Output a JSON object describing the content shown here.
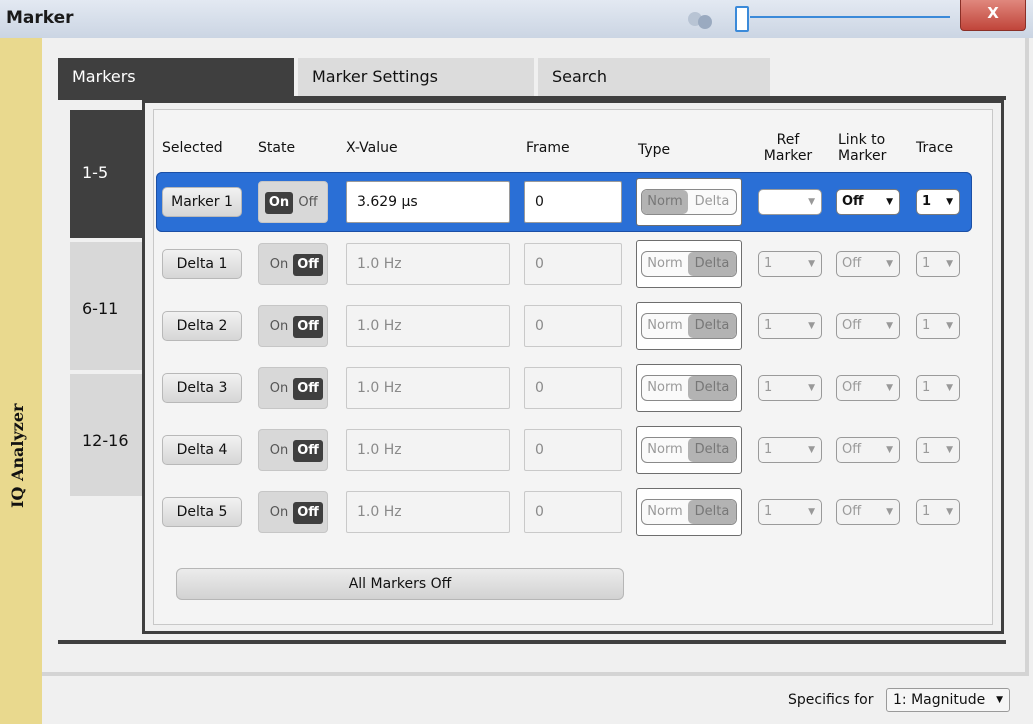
{
  "window": {
    "title": "Marker",
    "close_label": "X"
  },
  "sidebar": {
    "label": "IQ Analyzer"
  },
  "tabs": [
    "Markers",
    "Marker Settings",
    "Search"
  ],
  "side_tabs": [
    "1-5",
    "6-11",
    "12-16"
  ],
  "columns": {
    "selected": "Selected",
    "state": "State",
    "x_value": "X-Value",
    "frame": "Frame",
    "type": "Type",
    "ref_marker_1": "Ref",
    "ref_marker_2": "Marker",
    "link_to_marker_1": "Link to",
    "link_to_marker_2": "Marker",
    "trace": "Trace"
  },
  "rows": [
    {
      "name": "Marker 1",
      "on": "On",
      "off": "Off",
      "state": "On",
      "x_value": "3.629 µs",
      "frame": "0",
      "norm": "Norm",
      "delta": "Delta",
      "type": "Norm",
      "ref": "",
      "link": "Off",
      "trace": "1",
      "enabled": true
    },
    {
      "name": "Delta 1",
      "on": "On",
      "off": "Off",
      "state": "Off",
      "x_value": "1.0 Hz",
      "frame": "0",
      "norm": "Norm",
      "delta": "Delta",
      "type": "Delta",
      "ref": "1",
      "link": "Off",
      "trace": "1",
      "enabled": false
    },
    {
      "name": "Delta 2",
      "on": "On",
      "off": "Off",
      "state": "Off",
      "x_value": "1.0 Hz",
      "frame": "0",
      "norm": "Norm",
      "delta": "Delta",
      "type": "Delta",
      "ref": "1",
      "link": "Off",
      "trace": "1",
      "enabled": false
    },
    {
      "name": "Delta 3",
      "on": "On",
      "off": "Off",
      "state": "Off",
      "x_value": "1.0 Hz",
      "frame": "0",
      "norm": "Norm",
      "delta": "Delta",
      "type": "Delta",
      "ref": "1",
      "link": "Off",
      "trace": "1",
      "enabled": false
    },
    {
      "name": "Delta 4",
      "on": "On",
      "off": "Off",
      "state": "Off",
      "x_value": "1.0 Hz",
      "frame": "0",
      "norm": "Norm",
      "delta": "Delta",
      "type": "Delta",
      "ref": "1",
      "link": "Off",
      "trace": "1",
      "enabled": false
    },
    {
      "name": "Delta 5",
      "on": "On",
      "off": "Off",
      "state": "Off",
      "x_value": "1.0 Hz",
      "frame": "0",
      "norm": "Norm",
      "delta": "Delta",
      "type": "Delta",
      "ref": "1",
      "link": "Off",
      "trace": "1",
      "enabled": false
    }
  ],
  "all_markers_off": "All Markers Off",
  "specifics": {
    "label": "Specifics for",
    "value": "1: Magnitude"
  },
  "colors": {
    "selected_row": "#2a6fd6",
    "sidebar": "#e9d98e",
    "dark_tab": "#3f3f3f",
    "close_button": "#c0453a"
  }
}
